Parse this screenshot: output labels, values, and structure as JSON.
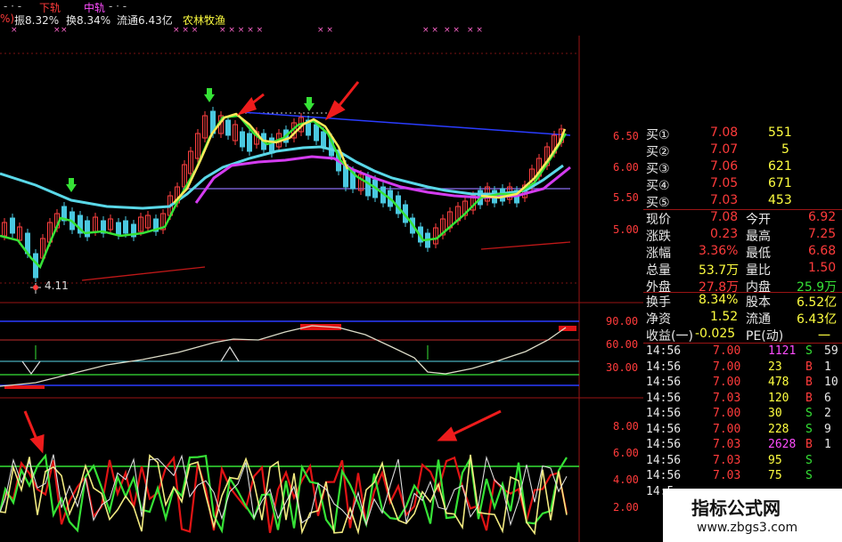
{
  "header": {
    "left_fragment": "- · -",
    "xia_gui": "下轨",
    "zhong_gui": "中轨",
    "dots": "- · -",
    "info_prefix": "%)",
    "zhen_fu": "振8.32%",
    "huan_shou": "换8.34%",
    "liu_tong": "流通6.43亿",
    "sector": "农林牧渔"
  },
  "price_axis": [
    "6.50",
    "6.00",
    "5.50",
    "5.00"
  ],
  "low_marker": "4.11",
  "osc_axis": [
    "90.00",
    "60.00",
    "30.00"
  ],
  "lower_axis": [
    "8.00",
    "6.00",
    "4.00",
    "2.00"
  ],
  "order_book": [
    {
      "label": "买①",
      "price": "7.08",
      "vol": "551"
    },
    {
      "label": "买②",
      "price": "7.07",
      "vol": "5"
    },
    {
      "label": "买③",
      "price": "7.06",
      "vol": "621"
    },
    {
      "label": "买④",
      "price": "7.05",
      "vol": "671"
    },
    {
      "label": "买⑤",
      "price": "7.03",
      "vol": "453"
    }
  ],
  "quote": [
    {
      "l1": "现价",
      "v1": "7.08",
      "l2": "今开",
      "v2": "6.92"
    },
    {
      "l1": "涨跌",
      "v1": "0.23",
      "l2": "最高",
      "v2": "7.25"
    },
    {
      "l1": "涨幅",
      "v1": "3.36%",
      "l2": "最低",
      "v2": "6.68"
    },
    {
      "l1": "总量",
      "v1": "53.7万",
      "l2": "量比",
      "v2": "1.50"
    },
    {
      "l1": "外盘",
      "v1": "27.8万",
      "l2": "内盘",
      "v2": "25.9万"
    }
  ],
  "stats": [
    {
      "l1": "换手",
      "v1": "8.34%",
      "l2": "股本",
      "v2": "6.52亿"
    },
    {
      "l1": "净资",
      "v1": "1.52",
      "l2": "流通",
      "v2": "6.43亿"
    },
    {
      "l1": "收益(一)",
      "v1": "-0.025",
      "l2": "PE(动)",
      "v2": "一"
    }
  ],
  "trades": [
    {
      "time": "14:56",
      "price": "7.00",
      "vol": "1121",
      "side": "S",
      "n": "59",
      "vol_color": "#ff4dff",
      "side_color": "#36e236"
    },
    {
      "time": "14:56",
      "price": "7.00",
      "vol": "23",
      "side": "B",
      "n": "1",
      "vol_color": "#ffff40",
      "side_color": "#ff3b3b"
    },
    {
      "time": "14:56",
      "price": "7.00",
      "vol": "478",
      "side": "B",
      "n": "10",
      "vol_color": "#ffff40",
      "side_color": "#ff3b3b"
    },
    {
      "time": "14:56",
      "price": "7.03",
      "vol": "120",
      "side": "B",
      "n": "6",
      "vol_color": "#ffff40",
      "side_color": "#ff3b3b"
    },
    {
      "time": "14:56",
      "price": "7.00",
      "vol": "30",
      "side": "S",
      "n": "2",
      "vol_color": "#ffff40",
      "side_color": "#36e236"
    },
    {
      "time": "14:56",
      "price": "7.00",
      "vol": "228",
      "side": "S",
      "n": "9",
      "vol_color": "#ffff40",
      "side_color": "#36e236"
    },
    {
      "time": "14:56",
      "price": "7.03",
      "vol": "2628",
      "side": "B",
      "n": "1",
      "vol_color": "#ff4dff",
      "side_color": "#ff3b3b"
    },
    {
      "time": "14:56",
      "price": "7.03",
      "vol": "95",
      "side": "S",
      "n": "",
      "vol_color": "#ffff40",
      "side_color": "#36e236"
    },
    {
      "time": "14:56",
      "price": "7.03",
      "vol": "75",
      "side": "S",
      "n": "",
      "vol_color": "#ffff40",
      "side_color": "#36e236"
    },
    {
      "time": "14:5",
      "price": "",
      "vol": "",
      "side": "",
      "n": "",
      "vol_color": "#ffff40",
      "side_color": "#36e236"
    }
  ],
  "watermark": {
    "title": "指标公式网",
    "url": "www.zbgs3.com"
  },
  "colors": {
    "up": "#ff3b3b",
    "down": "#36e236",
    "ma_cyan": "#5ad8e8",
    "ma_magenta": "#d43cf0",
    "line_yellow": "#ffe85a"
  }
}
